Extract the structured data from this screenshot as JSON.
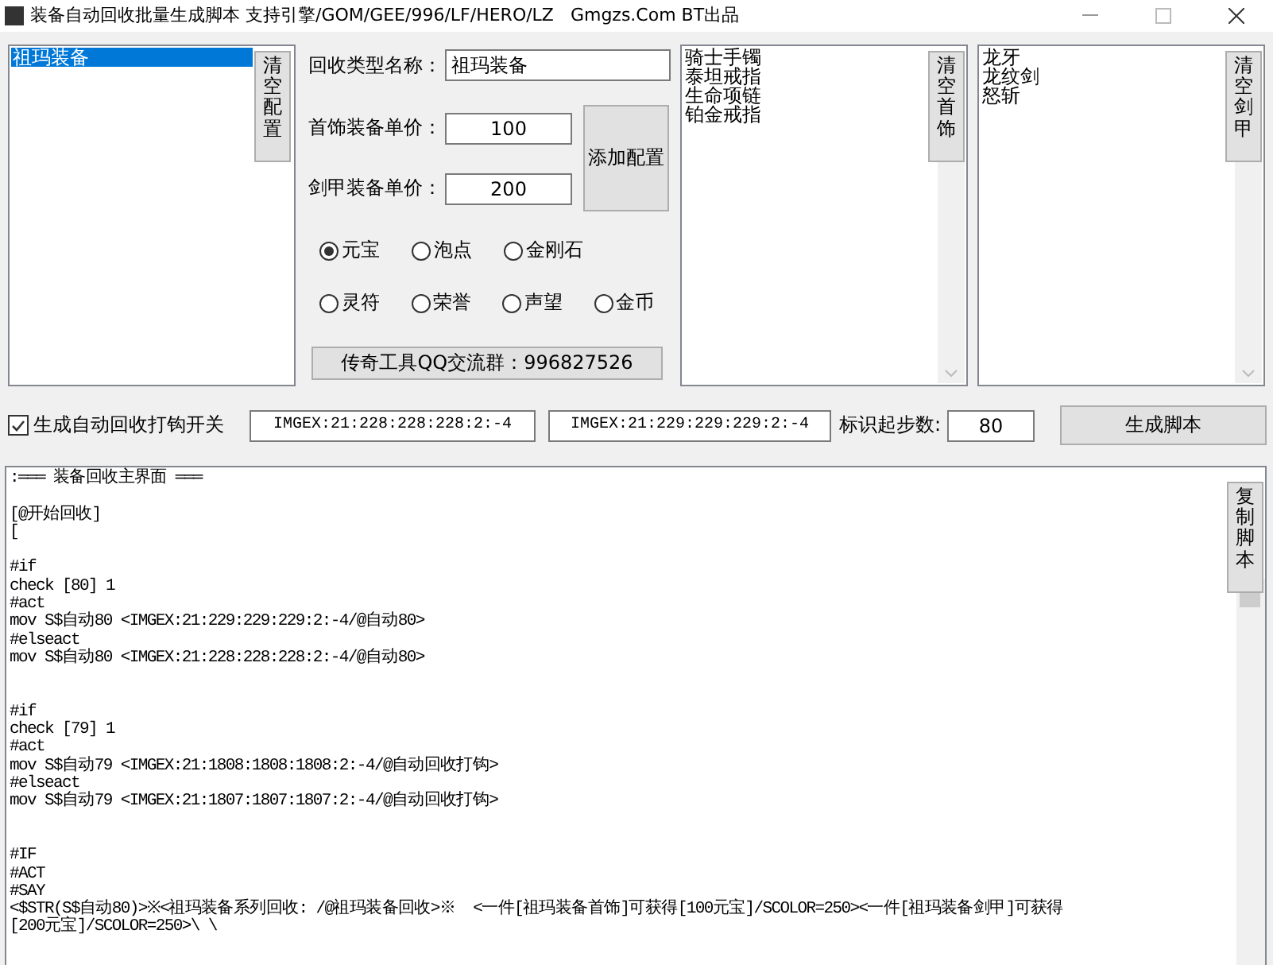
{
  "window": {
    "title": "装备自动回收批量生成脚本 支持引擎/GOM/GEE/996/LF/HERO/LZ   Gmgzs.Com BT出品"
  },
  "config_list": {
    "items": [
      {
        "label": "祖玛装备",
        "selected": true
      }
    ],
    "clear_button": "清空配置"
  },
  "form": {
    "type_name": {
      "label": "回收类型名称：",
      "value": "祖玛装备"
    },
    "jewelry_price": {
      "label": "首饰装备单价：",
      "value": "100"
    },
    "weapon_price": {
      "label": "剑甲装备单价：",
      "value": "200"
    },
    "add_button": "添加配置",
    "currencies": [
      {
        "label": "元宝",
        "selected": true
      },
      {
        "label": "泡点",
        "selected": false
      },
      {
        "label": "金刚石",
        "selected": false
      },
      {
        "label": "灵符",
        "selected": false
      },
      {
        "label": "荣誉",
        "selected": false
      },
      {
        "label": "声望",
        "selected": false
      },
      {
        "label": "金币",
        "selected": false
      }
    ],
    "qq_button": "传奇工具QQ交流群：996827526"
  },
  "jewelry_list": {
    "items": [
      "骑士手镯",
      "泰坦戒指",
      "生命项链",
      "铂金戒指"
    ],
    "clear_button": "清空首饰"
  },
  "weapon_list": {
    "items": [
      "龙牙",
      "龙纹剑",
      "怒斩"
    ],
    "clear_button": "清空剑甲"
  },
  "options": {
    "auto_hook": {
      "label": "生成自动回收打钩开关",
      "checked": true
    },
    "image_off": "IMGEX:21:228:228:228:2:-4",
    "image_on": "IMGEX:21:229:229:229:2:-4",
    "start_label": "标识起步数:",
    "start_value": "80",
    "generate_button": "生成脚本"
  },
  "script": {
    "copy_button": "复制脚本",
    "text": ":═══ 装备回收主界面 ═══\n\n[@开始回收]\n[\n\n#if\ncheck [80] 1\n#act\nmov S$自动80 <IMGEX:21:229:229:229:2:-4/@自动80>\n#elseact\nmov S$自动80 <IMGEX:21:228:228:228:2:-4/@自动80>\n\n\n#if\ncheck [79] 1\n#act\nmov S$自动79 <IMGEX:21:1808:1808:1808:2:-4/@自动回收打钩>\n#elseact\nmov S$自动79 <IMGEX:21:1807:1807:1807:2:-4/@自动回收打钩>\n\n\n#IF\n#ACT\n#SAY\n<$STR(S$自动80)>※<祖玛装备系列回收: /@祖玛装备回收>※  <一件[祖玛装备首饰]可获得[100元宝]/SCOLOR=250><一件[祖玛装备剑甲]可获得\n[200元宝]/SCOLOR=250>\\ \\"
  }
}
